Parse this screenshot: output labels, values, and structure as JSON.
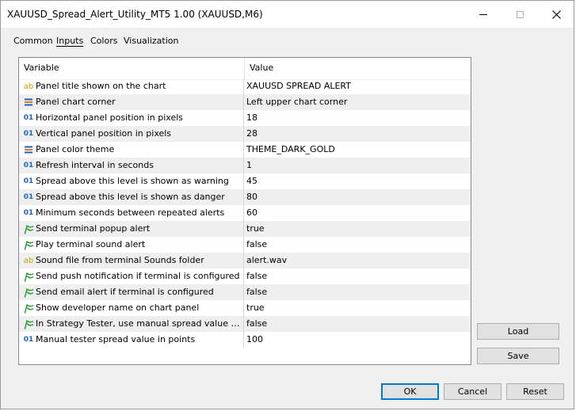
{
  "window": {
    "title": "XAUUSD_Spread_Alert_Utility_MT5 1.00 (XAUUSD,M6)"
  },
  "tabs": [
    {
      "label": "Common"
    },
    {
      "label": "Inputs",
      "active": true
    },
    {
      "label": "Colors"
    },
    {
      "label": "Visualization"
    }
  ],
  "grid": {
    "col_variable": "Variable",
    "col_value": "Value",
    "rows": [
      {
        "icon": "string-icon",
        "label": "Panel title shown on the chart",
        "value": "XAUUSD SPREAD ALERT"
      },
      {
        "icon": "enum-icon",
        "label": "Panel chart corner",
        "value": "Left upper chart corner"
      },
      {
        "icon": "integer-icon",
        "label": "Horizontal panel position in pixels",
        "value": "18"
      },
      {
        "icon": "integer-icon",
        "label": "Vertical panel position in pixels",
        "value": "28"
      },
      {
        "icon": "enum-icon",
        "label": "Panel color theme",
        "value": "THEME_DARK_GOLD"
      },
      {
        "icon": "integer-icon",
        "label": "Refresh interval in seconds",
        "value": "1"
      },
      {
        "icon": "integer-icon",
        "label": "Spread above this level is shown as warning",
        "value": "45"
      },
      {
        "icon": "integer-icon",
        "label": "Spread above this level is shown as danger",
        "value": "80"
      },
      {
        "icon": "integer-icon",
        "label": "Minimum seconds between repeated alerts",
        "value": "60"
      },
      {
        "icon": "bool-icon",
        "label": "Send terminal popup alert",
        "value": "true"
      },
      {
        "icon": "bool-icon",
        "label": "Play terminal sound alert",
        "value": "false"
      },
      {
        "icon": "string-icon",
        "label": "Sound file from terminal Sounds folder",
        "value": "alert.wav"
      },
      {
        "icon": "bool-icon",
        "label": "Send push notification if terminal is configured",
        "value": "false"
      },
      {
        "icon": "bool-icon",
        "label": "Send email alert if terminal is configured",
        "value": "false"
      },
      {
        "icon": "bool-icon",
        "label": "Show developer name on chart panel",
        "value": "true"
      },
      {
        "icon": "bool-icon",
        "label": "In Strategy Tester, use manual spread value for ch...",
        "value": "false"
      },
      {
        "icon": "integer-icon",
        "label": "Manual tester spread value in points",
        "value": "100"
      }
    ]
  },
  "icons": {
    "string_glyph": "ab",
    "integer_glyph": "01"
  },
  "colors": {
    "string_icon": "#c8a000",
    "integer_icon": "#1a63c7",
    "enum_icon": "#1a63c7",
    "bool_icon": "#2e9b2e",
    "default_button_border": "#0078d7"
  },
  "buttons": {
    "load": "Load",
    "save": "Save",
    "ok": "OK",
    "cancel": "Cancel",
    "reset": "Reset"
  }
}
